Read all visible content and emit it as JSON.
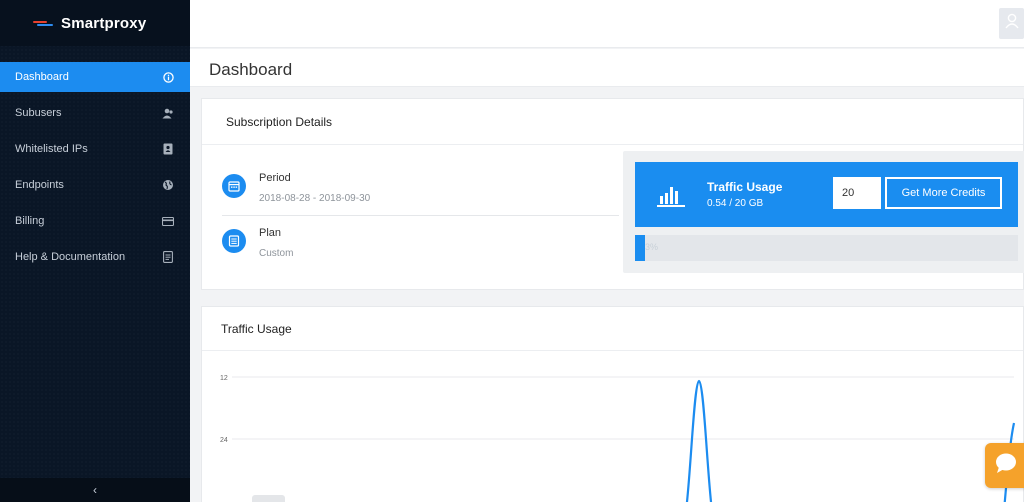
{
  "brand": {
    "name": "Smartproxy"
  },
  "sidebar": {
    "items": [
      {
        "label": "Dashboard",
        "icon": "info-icon",
        "active": true
      },
      {
        "label": "Subusers",
        "icon": "users-icon"
      },
      {
        "label": "Whitelisted IPs",
        "icon": "contact-book-icon"
      },
      {
        "label": "Endpoints",
        "icon": "globe-icon"
      },
      {
        "label": "Billing",
        "icon": "credit-card-icon"
      },
      {
        "label": "Help & Documentation",
        "icon": "document-icon"
      }
    ],
    "collapse_glyph": "‹"
  },
  "page": {
    "title": "Dashboard"
  },
  "subscription": {
    "header": "Subscription Details",
    "period_label": "Period",
    "period_value": "2018-08-28 - 2018-09-30",
    "plan_label": "Plan",
    "plan_value": "Custom"
  },
  "traffic": {
    "title": "Traffic Usage",
    "usage": "0.54 / 20 GB",
    "credits_input": "20",
    "button": "Get More Credits",
    "progress_text": "3%",
    "progress_fraction": 0.027
  },
  "usage_chart": {
    "header": "Traffic Usage"
  },
  "chart_data": {
    "type": "line",
    "title": "Traffic Usage",
    "y_tick_labels": [
      "12",
      "24"
    ],
    "series": [
      {
        "color": "#1c8cf0"
      }
    ]
  },
  "colors": {
    "accent": "#1c8cf0",
    "sidebar": "#0a1626",
    "chat": "#f5a22b"
  }
}
